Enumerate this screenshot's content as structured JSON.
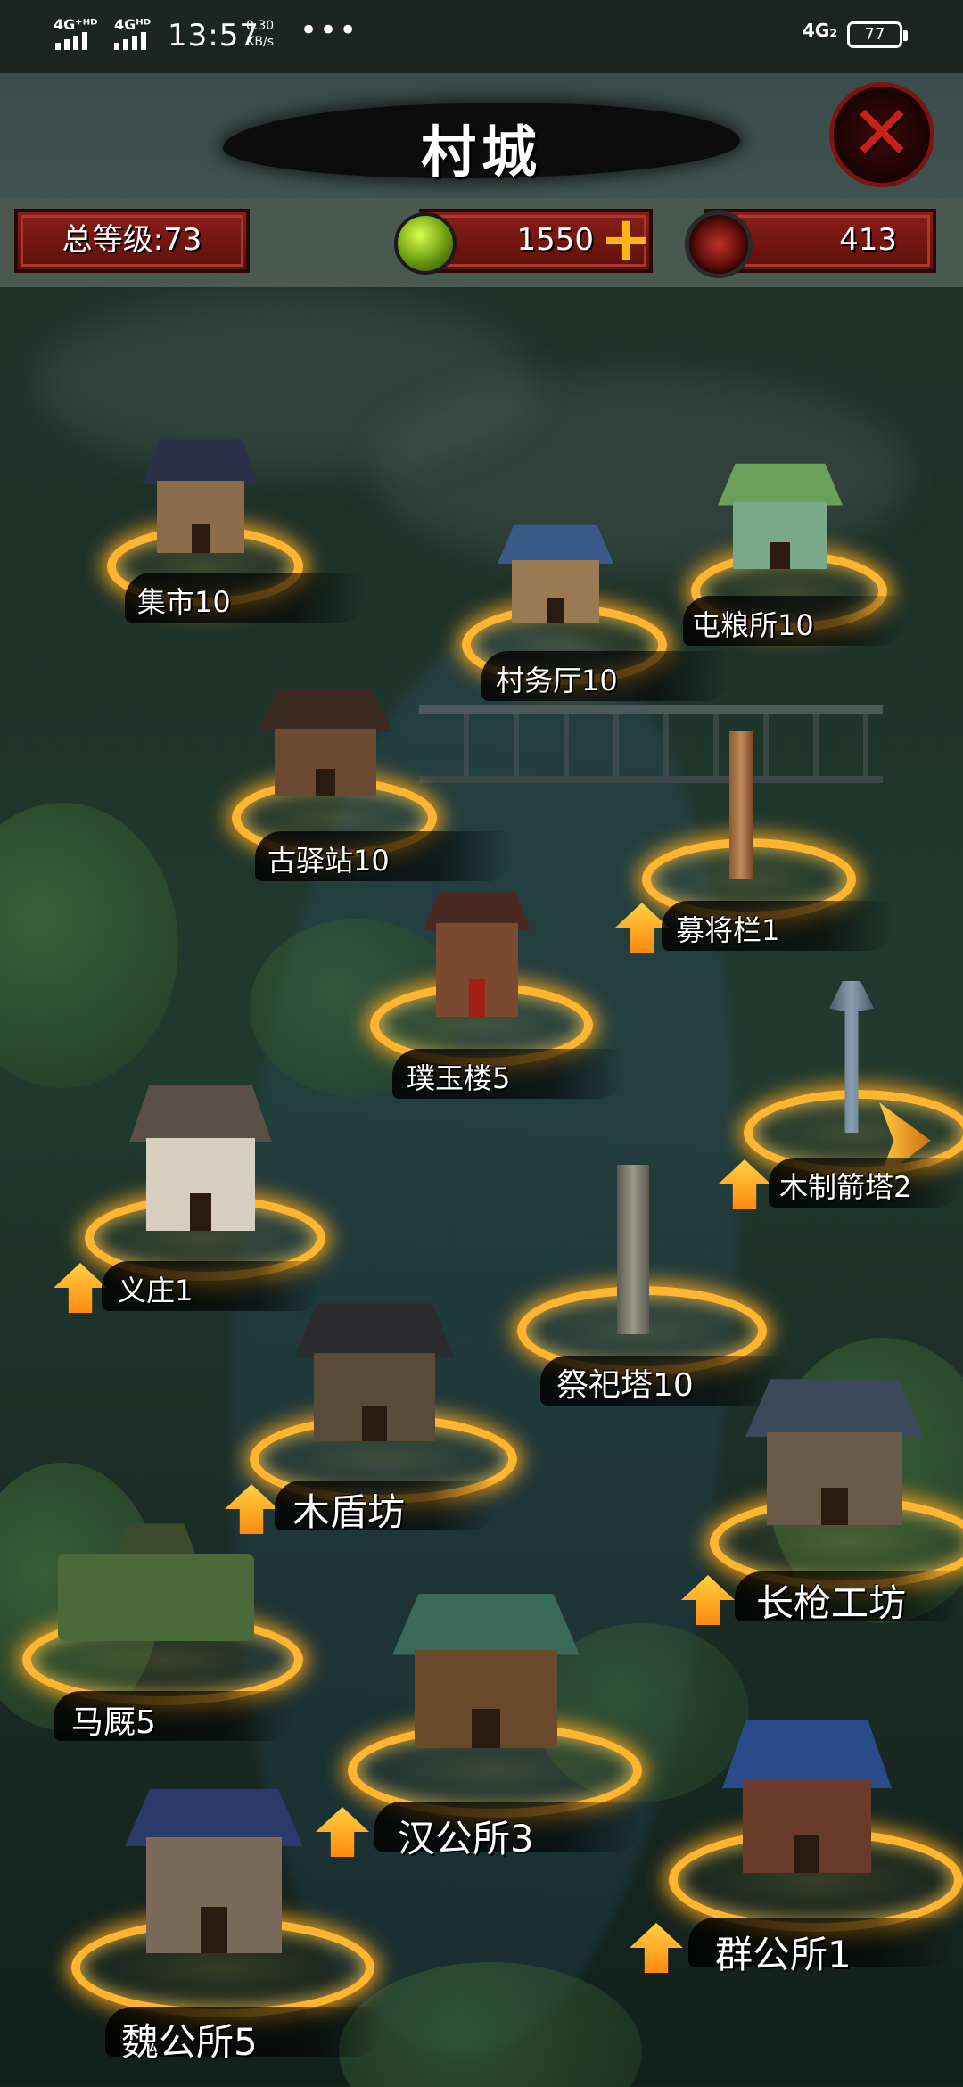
{
  "status_bar": {
    "signal_1": "4G⁺ᴴᴰ",
    "signal_2": "4Gᴴᴰ",
    "time": "13:57",
    "speed_value": "0.30",
    "speed_unit": "KB/s",
    "more": "•••",
    "network": "4G₂",
    "battery": "77"
  },
  "header": {
    "title": "村城",
    "close_icon": "close-x-icon"
  },
  "resources": {
    "total_level": "总等级:73",
    "coins": "1550",
    "coin_icon": "green-orb-icon",
    "plus_icon": "plus-icon",
    "gems": "413",
    "gem_icon": "red-medallion-icon"
  },
  "buildings": [
    {
      "label": "集市10",
      "upgrade": false
    },
    {
      "label": "村务厅10",
      "upgrade": false
    },
    {
      "label": "屯粮所10",
      "upgrade": false
    },
    {
      "label": "古驿站10",
      "upgrade": false
    },
    {
      "label": "募将栏1",
      "upgrade": true
    },
    {
      "label": "璞玉楼5",
      "upgrade": false
    },
    {
      "label": "木制箭塔2",
      "upgrade": true
    },
    {
      "label": "义庄1",
      "upgrade": true
    },
    {
      "label": "祭祀塔10",
      "upgrade": false
    },
    {
      "label": "木盾坊",
      "upgrade": true
    },
    {
      "label": "长枪工坊",
      "upgrade": true
    },
    {
      "label": "马厩5",
      "upgrade": false
    },
    {
      "label": "汉公所3",
      "upgrade": true
    },
    {
      "label": "群公所1",
      "upgrade": true
    },
    {
      "label": "魏公所5",
      "upgrade": false
    }
  ],
  "colors": {
    "ring": "#ffb530",
    "panel_red": "#8b1d17",
    "arrow_orange": "#ff8a10"
  }
}
